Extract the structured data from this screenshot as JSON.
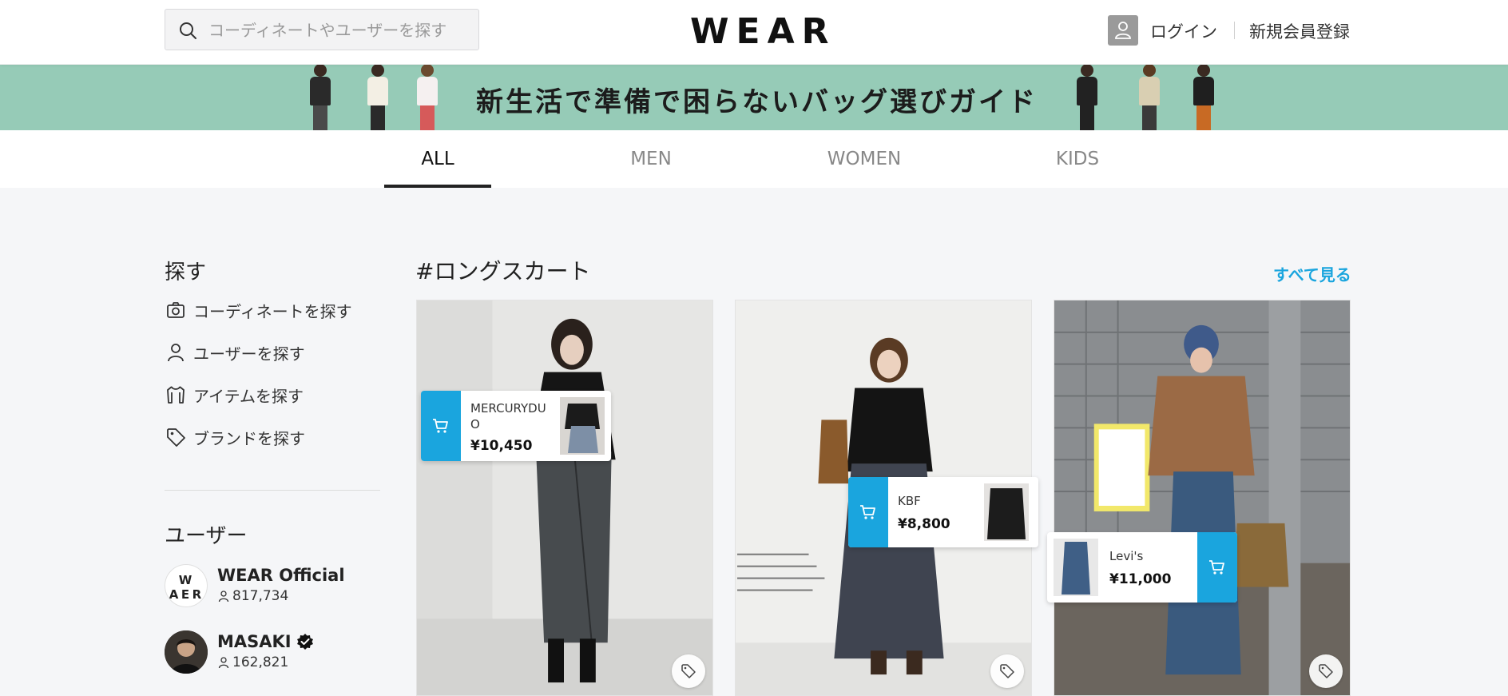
{
  "header": {
    "search_placeholder": "コーディネートやユーザーを探す",
    "logo": "WEAR",
    "login_label": "ログイン",
    "register_label": "新規会員登録"
  },
  "banner": {
    "text": "新生活で準備で困らないバッグ選びガイド"
  },
  "tabs": [
    {
      "label": "ALL",
      "active": true
    },
    {
      "label": "MEN",
      "active": false
    },
    {
      "label": "WOMEN",
      "active": false
    },
    {
      "label": "KIDS",
      "active": false
    }
  ],
  "sidebar": {
    "search_title": "探す",
    "items": [
      {
        "label": "コーディネートを探す",
        "icon": "camera-icon"
      },
      {
        "label": "ユーザーを探す",
        "icon": "person-icon"
      },
      {
        "label": "アイテムを探す",
        "icon": "shirt-icon"
      },
      {
        "label": "ブランドを探す",
        "icon": "tag-icon"
      }
    ],
    "users_title": "ユーザー",
    "users": [
      {
        "name": "WEAR Official",
        "followers": "817,734",
        "avatar_letters": [
          "W E",
          "A R"
        ]
      },
      {
        "name": "MASAKI",
        "followers": "162,821",
        "verified": true
      }
    ]
  },
  "section": {
    "title": "#ロングスカート",
    "see_all": "すべて見る"
  },
  "cards": [
    {
      "item_brand": "MERCURYDUO",
      "item_price": "¥10,450"
    },
    {
      "item_brand": "KBF",
      "item_price": "¥8,800"
    },
    {
      "item_brand": "Levi's",
      "item_price": "¥11,000"
    }
  ],
  "colors": {
    "accent": "#1aa5de",
    "banner_bg": "#96cbb7",
    "page_bg": "#f5f6f8"
  }
}
